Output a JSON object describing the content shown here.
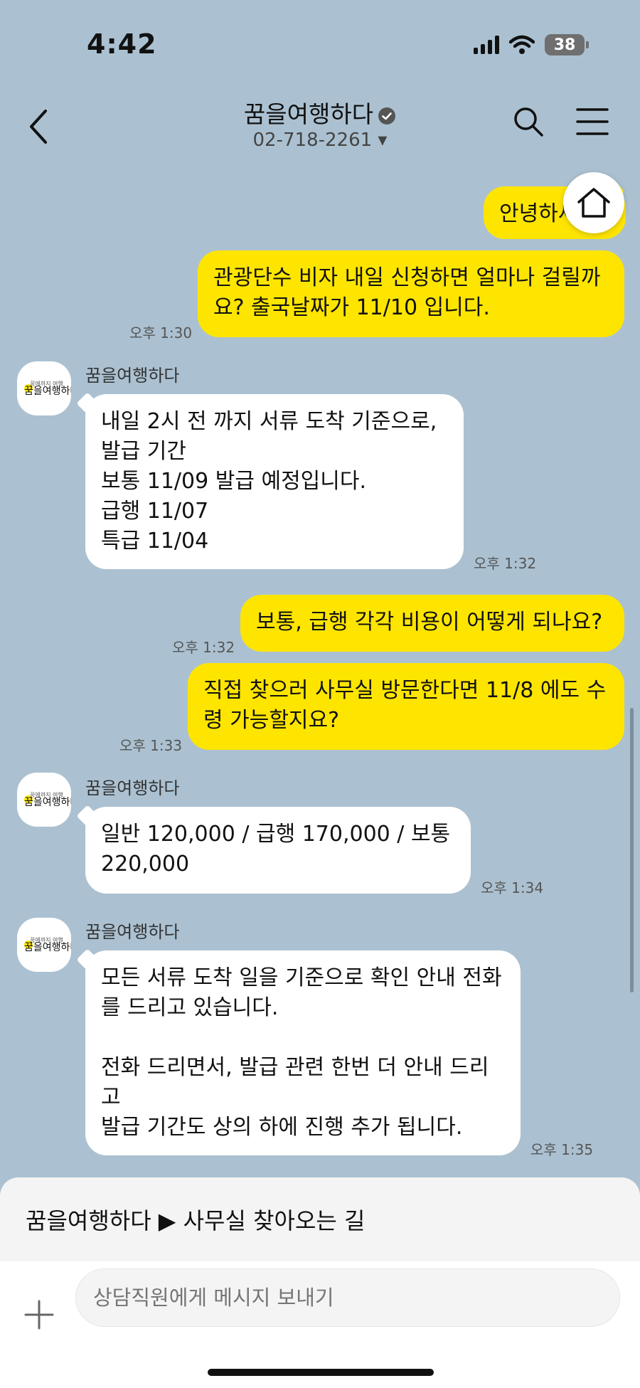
{
  "status_bar": {
    "time": "4:42",
    "battery": "38"
  },
  "header": {
    "title": "꿈을여행하다",
    "phone": "02-718-2261 ▾"
  },
  "messages": [
    {
      "from": "me",
      "text": "안녕하세요"
    },
    {
      "from": "me",
      "text": "관광단수 비자 내일 신청하면 얼마나 걸릴까\n요? 출국날짜가 11/10 입니다.",
      "time": "오후 1:30"
    },
    {
      "from": "bot",
      "sender": "꿈을여행하다",
      "text": "내일 2시 전 까지 서류 도착 기준으로,\n발급 기간\n보통 11/09 발급 예정입니다.\n급행 11/07\n특급 11/04",
      "time": "오후 1:32"
    },
    {
      "from": "me",
      "text": "보통, 급행 각각 비용이 어떻게 되나요?",
      "time": "오후 1:32"
    },
    {
      "from": "me",
      "text": "직접 찾으러 사무실 방문한다면 11/8 에도 수\n령 가능할지요?",
      "time": "오후 1:33"
    },
    {
      "from": "bot",
      "sender": "꿈을여행하다",
      "text": "일반 120,000 / 급행 170,000 / 보통\n220,000",
      "time": "오후 1:34"
    },
    {
      "from": "bot",
      "sender": "꿈을여행하다",
      "text": "모든 서류 도착 일을 기준으로 확인 안내 전화\n를 드리고 있습니다.\n\n전화 드리면서, 발급 관련 한번 더 안내 드리\n고\n발급 기간도 상의 하에 진행 추가 됩니다.",
      "time": "오후 1:35"
    }
  ],
  "quick_menu": {
    "label": "꿈을여행하다 ▶ 사무실 찾아오는 길"
  },
  "input": {
    "placeholder": "상담직원에게 메시지 보내기"
  },
  "colors": {
    "background": "#abc1d1",
    "my_bubble": "#fee500",
    "bot_bubble": "#ffffff"
  },
  "icons": [
    "back-arrow-icon",
    "verified-icon",
    "search-icon",
    "menu-icon",
    "home-icon",
    "plus-icon",
    "wifi-icon",
    "signal-icon",
    "battery-icon"
  ]
}
